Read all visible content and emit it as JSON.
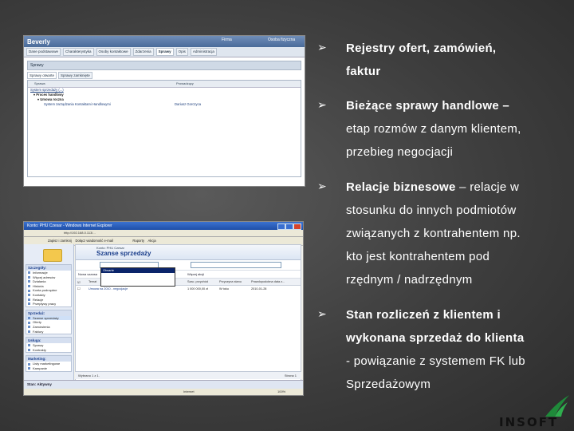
{
  "screenshot1": {
    "title": "Beverly",
    "title_right": [
      "Firma",
      "Osoba fizyczna"
    ],
    "tabs": [
      "Dane podstawowe",
      "Charakterystyka",
      "Osoby kontaktowe",
      "Zdarzenia",
      "Sprawy",
      "Opis",
      "Administracja"
    ],
    "active_tab_index": 4,
    "section": "Sprawy",
    "subtabs": [
      "Sprawy otwarte",
      "Sprawy zamknięte"
    ],
    "grid_headers": [
      "Sprawa",
      "Prowadzący"
    ],
    "rows": [
      {
        "label": "System sprzedaży (...)",
        "owner": ""
      },
      {
        "label": "Proces handlowy",
        "owner": ""
      },
      {
        "label": "Umowa roczna",
        "owner": ""
      },
      {
        "label": "System zarządzania Kontaktami Handlowymi",
        "owner": "Dariusz Gorczyca"
      }
    ]
  },
  "screenshot2": {
    "window_title": "Konto: PHU Czesar - Windows Internet Explorer",
    "address": "http://192.168.0.113/...",
    "toolbar": [
      "Zapisz i zamknij",
      "Dołącz wiadomość e-mail",
      "Raporty",
      "Akcja"
    ],
    "left_groups": [
      {
        "header": "Szczegóły:",
        "items": [
          "Informacje",
          "Więcej adresów",
          "Działania",
          "Historia",
          "Konta podrzędne",
          "Kontakty",
          "Relacje",
          "Przepływy pracy"
        ]
      },
      {
        "header": "Sprzedaż:",
        "items": [
          "Szanse sprzedaży",
          "Oferty",
          "Zamówienia",
          "Faktury"
        ],
        "selected": "Szanse sprzedaży"
      },
      {
        "header": "Usługa:",
        "items": [
          "Sprawy",
          "Kontrakty"
        ]
      },
      {
        "header": "Marketing:",
        "items": [
          "Listy marketingowe",
          "Kampanie"
        ]
      }
    ],
    "entity_label": "Konto: PHU Czesar",
    "view_title": "Szanse sprzedaży",
    "filter_label": "Filtr widzenia:",
    "filter_value": "Otwarte",
    "relation_label": "Dotyczy:",
    "relation_value": "Rekordy pokrewne pola \"Dotyczy\"",
    "new_label": "Nowa szansa",
    "more_actions": "Więcej akcji",
    "dropdown_options": [
      "Otwarte",
      "Wykorzystane",
      "Utracone",
      "Wszystkie"
    ],
    "highlighted_option": "Otwarte",
    "columns": [
      "Temat",
      "Potencjalny klient",
      "Szac. przychód",
      "Przyczyna stanu",
      "Prawdopodobna data z..."
    ],
    "rows": [
      {
        "topic": "Umowa na 2010 - negocjacje",
        "client": "",
        "revenue": "1 000 000,00 zł",
        "reason": "W toku",
        "date": "2010-01-28"
      }
    ],
    "footer_left": "Wybrano 1 z 1.",
    "footer_right": "Strona 1",
    "status_bar": "Stan: Aktywny",
    "ie_zone": "Internet",
    "ie_zoom": "100%"
  },
  "bullets": [
    {
      "bold": "Rejestry ofert, zamówień,",
      "rest": "",
      "lines": [
        "Rejestry ofert, zamówień,",
        "faktur"
      ],
      "bold_lines": 2
    },
    {
      "lines": [
        "Bieżące sprawy handlowe –",
        "etap  rozmów z danym klientem,",
        "przebieg negocjacji"
      ],
      "bold_lines": 1
    },
    {
      "lines": [
        "Relacje biznesowe",
        " – relacje w",
        "stosunku do innych podmiotów",
        "związanych z kontrahentem np.",
        "kto jest kontrahentem pod",
        "rzędnym / nadrzędnym"
      ]
    },
    {
      "lines": [
        "Stan rozliczeń z klientem i",
        "wykonana sprzedaż do klienta",
        "- powiązanie z systemem FK lub",
        "Sprzedażowym"
      ],
      "bold_lines": 2
    }
  ],
  "logo_text": "INSOFT",
  "colors": {
    "logo_green": "#1f8a3a",
    "background": "#404040"
  }
}
